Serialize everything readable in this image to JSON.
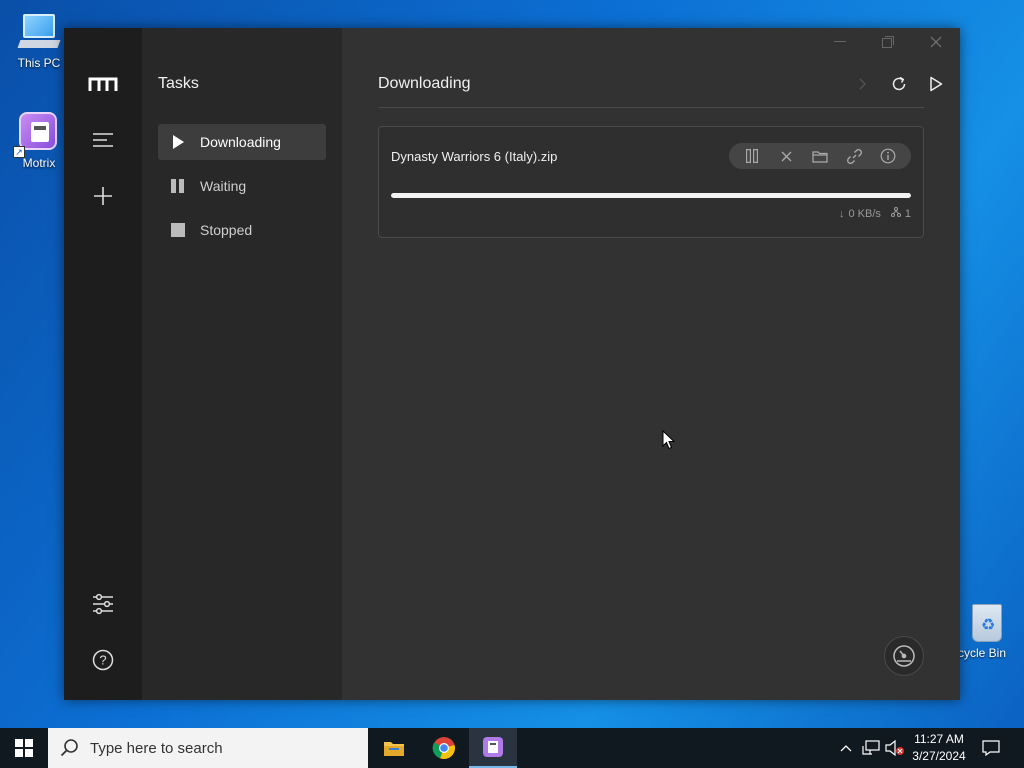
{
  "desktop": {
    "icons": [
      {
        "label": "This PC"
      },
      {
        "label": "Motrix"
      },
      {
        "label": "cycle Bin"
      }
    ]
  },
  "app": {
    "panel_title": "Tasks",
    "tasks_nav": [
      {
        "label": "Downloading",
        "icon": "play-icon",
        "active": true
      },
      {
        "label": "Waiting",
        "icon": "pause-icon",
        "active": false
      },
      {
        "label": "Stopped",
        "icon": "stop-icon",
        "active": false
      }
    ],
    "main_title": "Downloading",
    "task": {
      "name": "Dynasty Warriors 6 (Italy).zip",
      "progress_percent": 100,
      "speed": "0 KB/s",
      "connections": "1"
    }
  },
  "taskbar": {
    "search_placeholder": "Type here to search",
    "time": "11:27 AM",
    "date": "3/27/2024"
  },
  "colors": {
    "rail_bg": "#1d1d1d",
    "panel_bg": "#282828",
    "main_bg": "#323232",
    "accent": "#f2f2f2"
  }
}
